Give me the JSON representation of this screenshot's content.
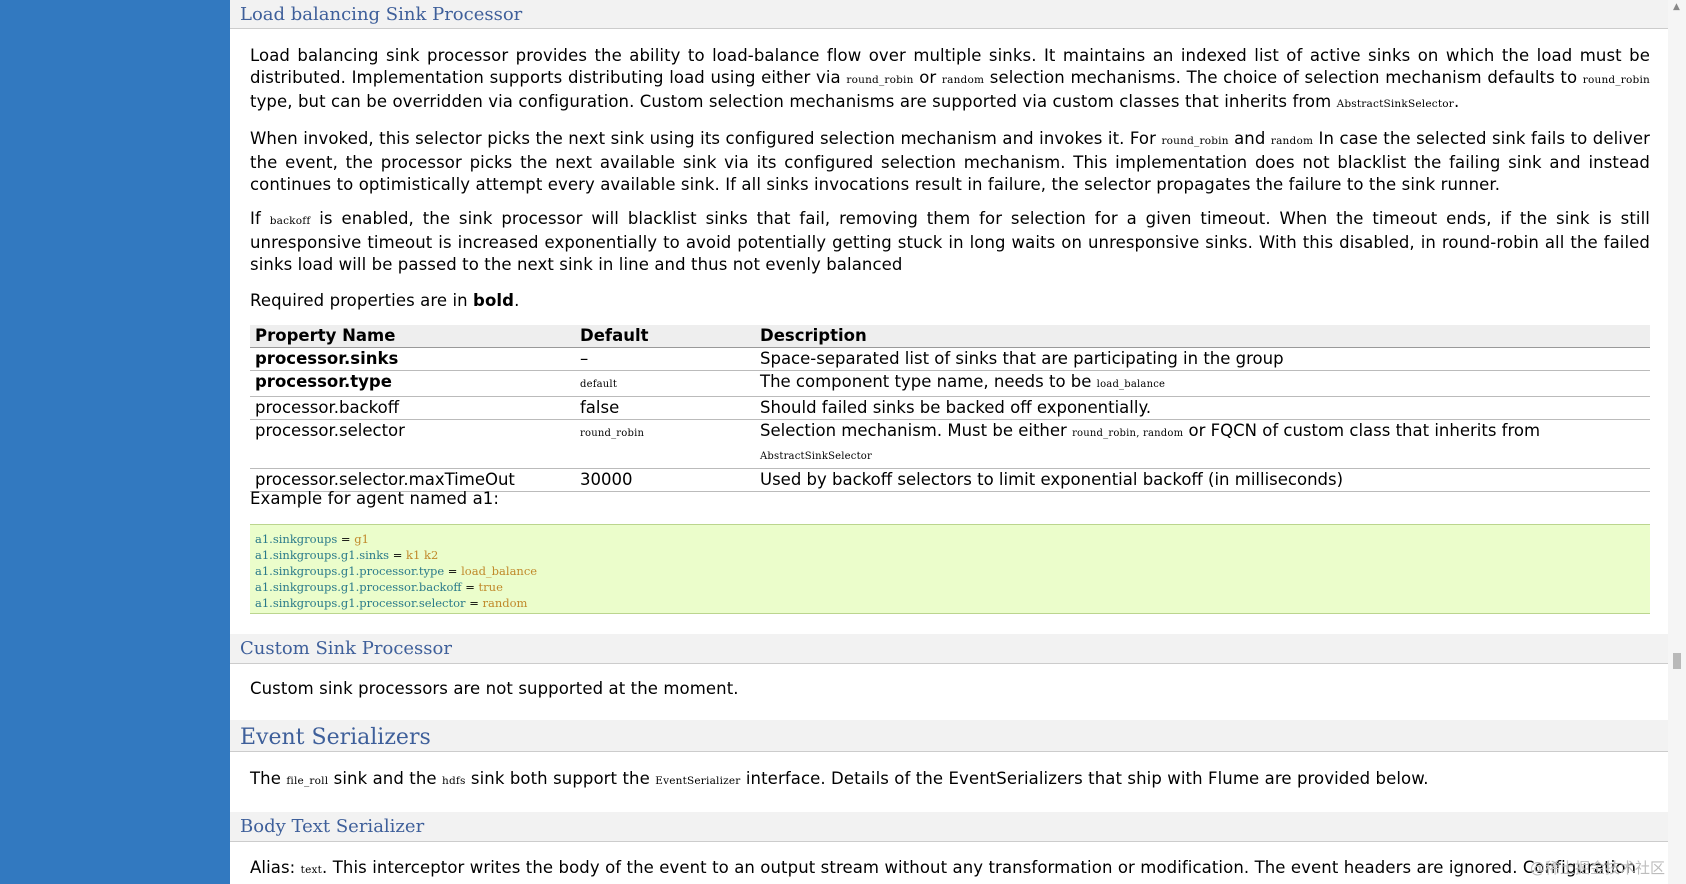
{
  "sections": {
    "load_balancing": {
      "title": "Load balancing Sink Processor",
      "p1": {
        "t1": "Load balancing sink processor provides the ability to load-balance flow over multiple sinks. It maintains an indexed list of active sinks on which the load must be distributed. Implementation supports distributing load using either via ",
        "c1": "round_robin",
        "t2": " or ",
        "c2": "random",
        "t3": " selection mechanisms. The choice of selection mechanism defaults to ",
        "c3": "round_robin",
        "t4": " type, but can be overridden via configuration. Custom selection mechanisms are supported via custom classes that inherits from ",
        "c4": "AbstractSinkSelector",
        "t5": "."
      },
      "p2": {
        "t1": "When invoked, this selector picks the next sink using its configured selection mechanism and invokes it. For ",
        "c1": "round_robin",
        "t2": " and ",
        "c2": "random",
        "t3": " In case the selected sink fails to deliver the event, the processor picks the next available sink via its configured selection mechanism. This implementation does not blacklist the failing sink and instead continues to optimistically attempt every available sink. If all sinks invocations result in failure, the selector propagates the failure to the sink runner."
      },
      "p3": {
        "t1": "If ",
        "c1": "backoff",
        "t2": " is enabled, the sink processor will blacklist sinks that fail, removing them for selection for a given timeout. When the timeout ends, if the sink is still unresponsive timeout is increased exponentially to avoid potentially getting stuck in long waits on unresponsive sinks. With this disabled, in round-robin all the failed sinks load will be passed to the next sink in line and thus not evenly balanced"
      },
      "p4": {
        "t1": "Required properties are in ",
        "b1": "bold",
        "t2": "."
      },
      "table": {
        "headers": [
          "Property Name",
          "Default",
          "Description"
        ],
        "rows": [
          {
            "name": "processor.sinks",
            "default": "–",
            "desc": "Space-separated list of sinks that are participating in the group"
          },
          {
            "name": "processor.type",
            "default": "default",
            "desc_t1": "The component type name, needs to be ",
            "desc_c1": "load_balance"
          },
          {
            "name": "processor.backoff",
            "default": "false",
            "desc": "Should failed sinks be backed off exponentially."
          },
          {
            "name": "processor.selector",
            "default": "round_robin",
            "desc_t1": "Selection mechanism. Must be either ",
            "desc_c1": "round_robin",
            "desc_t2": ", ",
            "desc_c2": "random",
            "desc_t3": " or FQCN of custom class that inherits from ",
            "desc_c3": "AbstractSinkSelector"
          },
          {
            "name": "processor.selector.maxTimeOut",
            "default": "30000",
            "desc": "Used by backoff selectors to limit exponential backoff (in milliseconds)"
          }
        ]
      },
      "example_label": "Example for agent named a1:",
      "code": [
        {
          "key": "a1.sinkgroups",
          "eq": " = ",
          "val": "g1"
        },
        {
          "key": "a1.sinkgroups.g1.sinks",
          "eq": " = ",
          "val": "k1 k2"
        },
        {
          "key": "a1.sinkgroups.g1.processor.type",
          "eq": " = ",
          "val": "load_balance"
        },
        {
          "key": "a1.sinkgroups.g1.processor.backoff",
          "eq": " = ",
          "val": "true"
        },
        {
          "key": "a1.sinkgroups.g1.processor.selector",
          "eq": " = ",
          "val": "random"
        }
      ]
    },
    "custom_sink": {
      "title": "Custom Sink Processor",
      "p1": "Custom sink processors are not supported at the moment."
    },
    "event_serializers": {
      "title": "Event Serializers",
      "p1": {
        "t1": "The ",
        "c1": "file_roll",
        "t2": " sink and the ",
        "c2": "hdfs",
        "t3": " sink both support the ",
        "c3": "EventSerializer",
        "t4": " interface. Details of the EventSerializers that ship with Flume are provided below."
      }
    },
    "body_text": {
      "title": "Body Text Serializer",
      "p1": {
        "t1": "Alias: ",
        "c1": "text",
        "t2": ". This interceptor writes the body of the event to an output stream without any transformation or modification. The event headers are ignored. Configuration"
      }
    }
  },
  "watermark": "@稀土掘金技术社区",
  "colors": {
    "sidebar": "#3279c0",
    "heading": "#3e5f9a",
    "code_bg": "#ebfdcb"
  }
}
